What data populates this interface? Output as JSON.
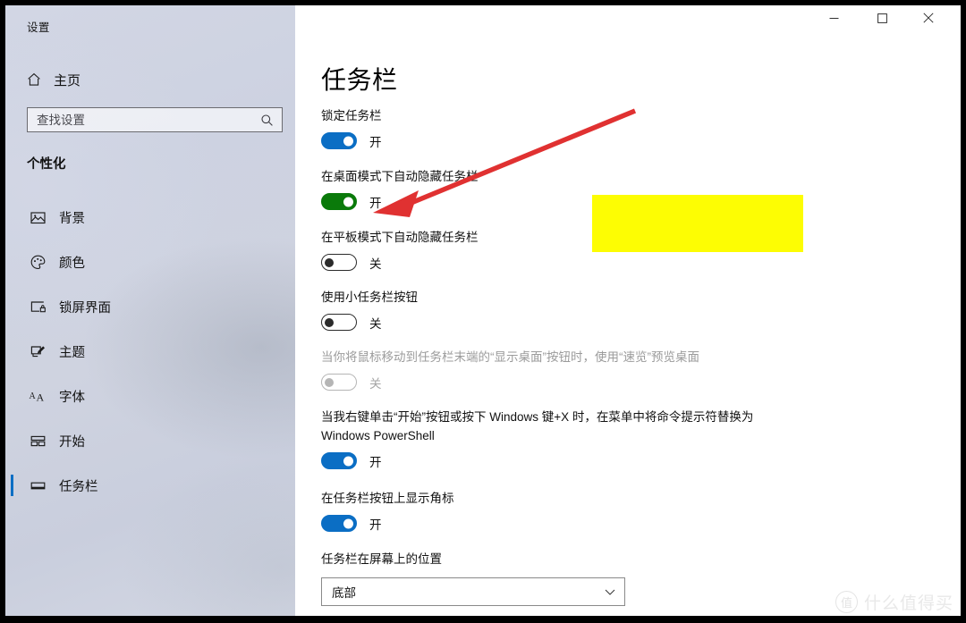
{
  "window": {
    "app_title": "设置",
    "controls": {
      "minimize": "minimize-icon",
      "maximize": "maximize-icon",
      "close": "close-icon"
    }
  },
  "sidebar": {
    "home_label": "主页",
    "home_icon": "home-icon",
    "search": {
      "placeholder": "查找设置",
      "value": "",
      "icon": "search-icon"
    },
    "category_heading": "个性化",
    "items": [
      {
        "label": "背景",
        "icon": "image-icon",
        "selected": false
      },
      {
        "label": "颜色",
        "icon": "palette-icon",
        "selected": false
      },
      {
        "label": "锁屏界面",
        "icon": "lock-screen-icon",
        "selected": false
      },
      {
        "label": "主题",
        "icon": "theme-brush-icon",
        "selected": false
      },
      {
        "label": "字体",
        "icon": "font-aa-icon",
        "selected": false
      },
      {
        "label": "开始",
        "icon": "start-tiles-icon",
        "selected": false
      },
      {
        "label": "任务栏",
        "icon": "taskbar-icon",
        "selected": true
      }
    ]
  },
  "main": {
    "page_title": "任务栏",
    "settings": [
      {
        "label": "锁定任务栏",
        "type": "toggle",
        "state_label": "开",
        "on": true,
        "disabled": false,
        "accent": "#0b6ec4"
      },
      {
        "label": "在桌面模式下自动隐藏任务栏",
        "type": "toggle",
        "state_label": "开",
        "on": true,
        "disabled": false,
        "accent": "#0a7a0a",
        "highlighted": true
      },
      {
        "label": "在平板模式下自动隐藏任务栏",
        "type": "toggle",
        "state_label": "关",
        "on": false,
        "disabled": false
      },
      {
        "label": "使用小任务栏按钮",
        "type": "toggle",
        "state_label": "关",
        "on": false,
        "disabled": false
      },
      {
        "label": "当你将鼠标移动到任务栏末端的“显示桌面”按钮时，使用“速览”预览桌面",
        "type": "toggle",
        "state_label": "关",
        "on": false,
        "disabled": true
      },
      {
        "label": "当我右键单击“开始”按钮或按下 Windows 键+X 时，在菜单中将命令提示符替换为 Windows PowerShell",
        "type": "toggle",
        "state_label": "开",
        "on": true,
        "disabled": false,
        "accent": "#0b6ec4"
      },
      {
        "label": "在任务栏按钮上显示角标",
        "type": "toggle",
        "state_label": "开",
        "on": true,
        "disabled": false,
        "accent": "#0b6ec4"
      },
      {
        "label": "任务栏在屏幕上的位置",
        "type": "dropdown",
        "value": "底部",
        "icon": "chevron-down-icon"
      }
    ]
  },
  "annotation": {
    "highlight_color": "#fdfd03",
    "arrow_color": "#e03131"
  },
  "watermark": {
    "badge": "值",
    "text": "什么值得买"
  }
}
